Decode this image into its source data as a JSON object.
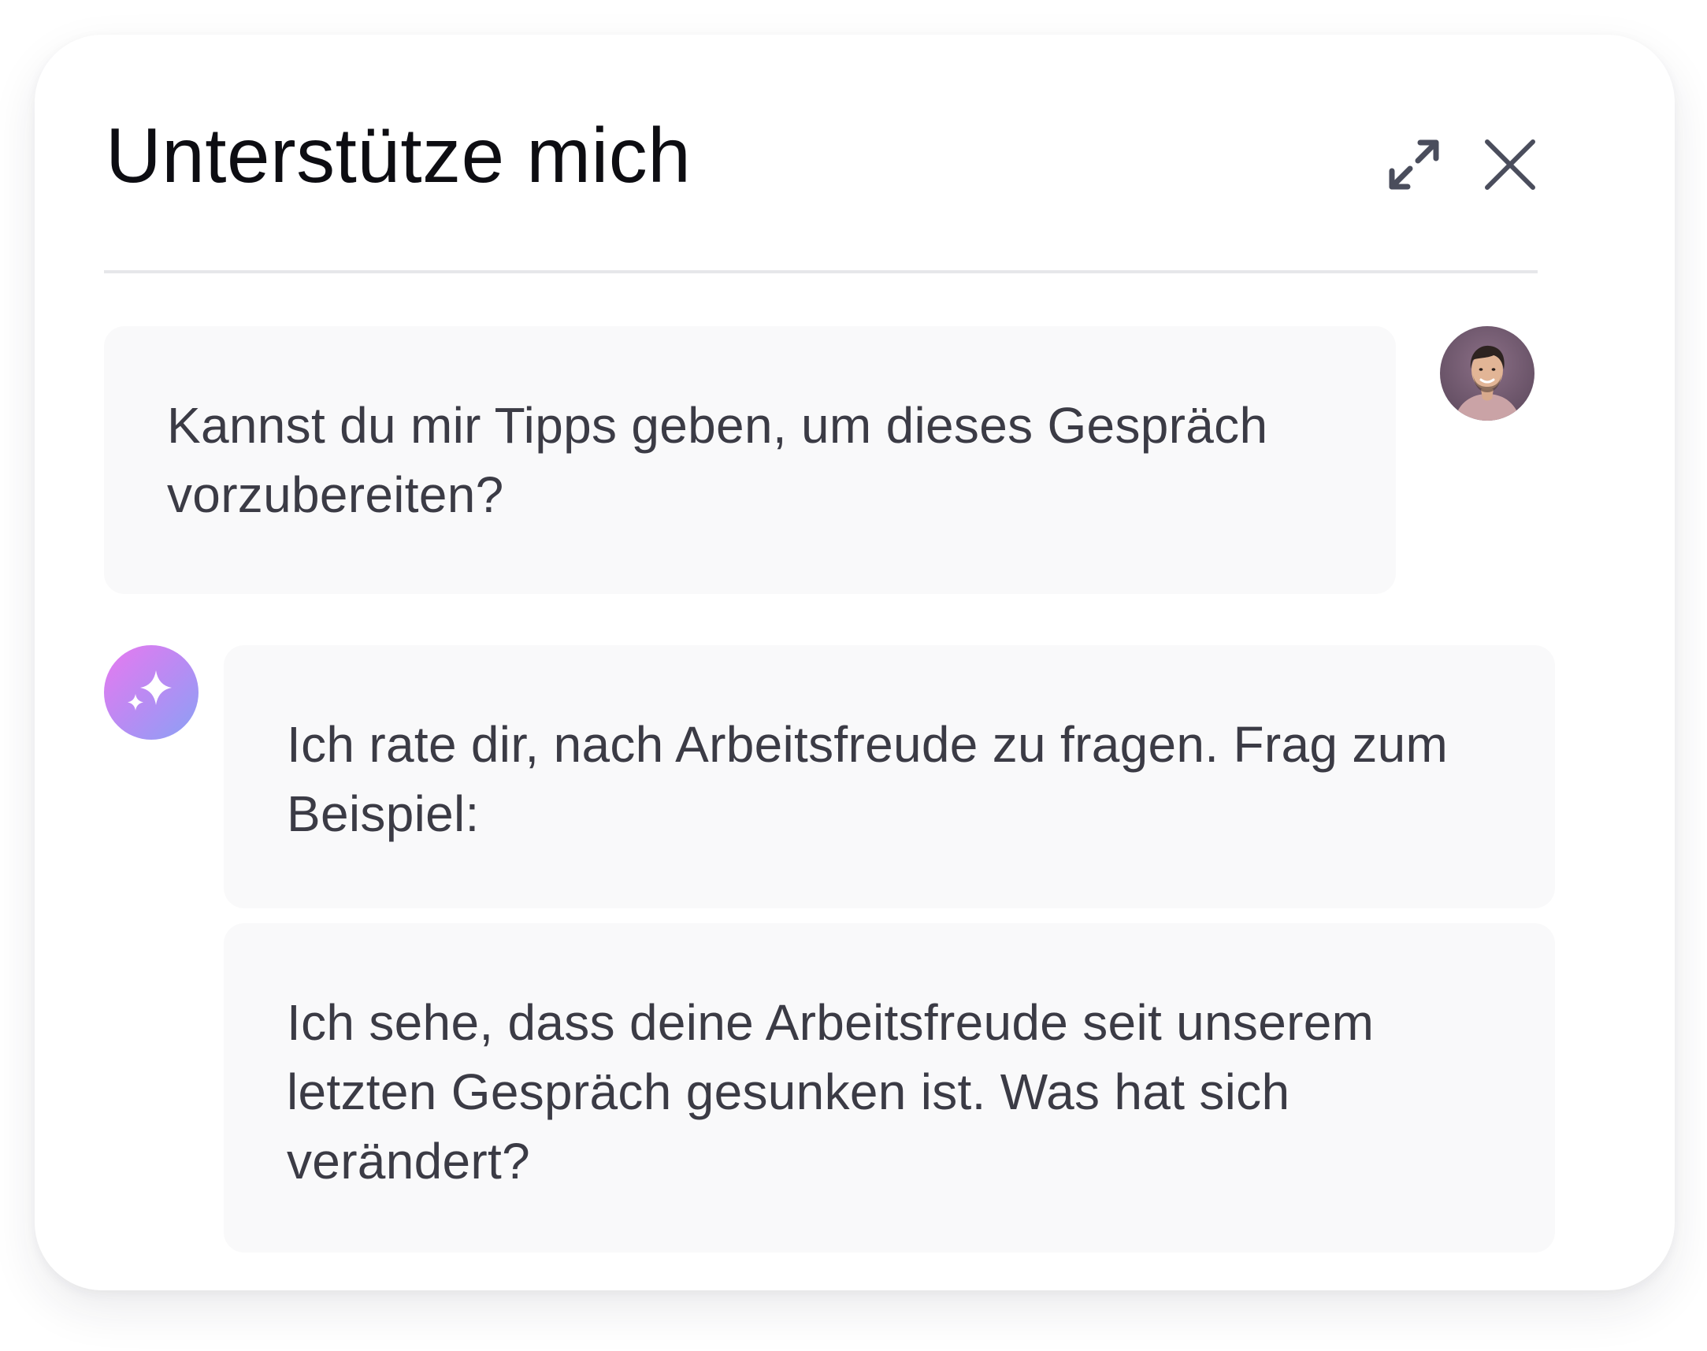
{
  "header": {
    "title": "Unterstütze mich",
    "expand_icon": "expand-arrows-icon",
    "close_icon": "close-icon"
  },
  "messages": [
    {
      "sender": "user",
      "avatar": "user-photo-avatar",
      "text": "Kannst du mir Tipps geben, um dieses Gespräch vorzubereiten?"
    },
    {
      "sender": "assistant",
      "avatar": "sparkle-icon",
      "text": "Ich rate dir, nach Arbeitsfreude zu fragen. Frag zum Beispiel:"
    },
    {
      "sender": "assistant",
      "text": "Ich sehe, dass deine Arbeitsfreude seit unserem letzten Gespräch gesunken ist. Was hat sich verändert?"
    }
  ],
  "colors": {
    "title": "#0d0d12",
    "message_text": "#3b3b45",
    "bubble_background": "#f9f9fa",
    "icon": "#4a4d5c",
    "divider": "#e6e7ea",
    "ai_gradient_start": "#e879f0",
    "ai_gradient_end": "#8aa1f5"
  }
}
